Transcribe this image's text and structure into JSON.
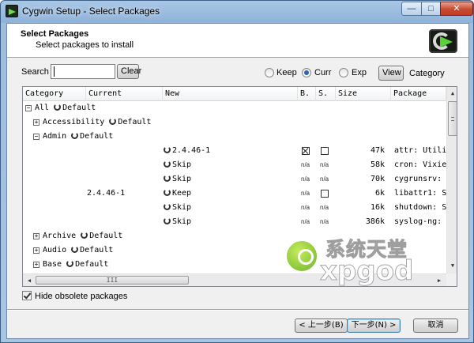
{
  "window": {
    "title": "Cygwin Setup - Select Packages",
    "minimize": "—",
    "maximize": "□",
    "close": "✕"
  },
  "header": {
    "title": "Select Packages",
    "subtitle": "Select packages to install"
  },
  "search": {
    "label": "Search",
    "value": "",
    "clear_label": "Clear"
  },
  "view_mode": {
    "options": [
      "Keep",
      "Curr",
      "Exp"
    ],
    "selected": "Curr",
    "view_button": "View",
    "current_view": "Category"
  },
  "columns": [
    "Category",
    "Current",
    "New",
    "B.",
    "S.",
    "Size",
    "Package"
  ],
  "tree": {
    "all": "All",
    "accessibility": "Accessibility",
    "admin": "Admin",
    "archive": "Archive",
    "audio": "Audio",
    "base": "Base",
    "default": "Default",
    "expand_sign": "+",
    "collapse_sign": "−"
  },
  "packages": [
    {
      "current": "",
      "new": "2.4.46-1",
      "bin": "checked",
      "src": "unchecked",
      "size": "47k",
      "package": "attr: Utili"
    },
    {
      "current": "",
      "new": "Skip",
      "bin": "n/a",
      "src": "n/a",
      "size": "58k",
      "package": "cron: Vixie"
    },
    {
      "current": "",
      "new": "Skip",
      "bin": "n/a",
      "src": "n/a",
      "size": "70k",
      "package": "cygrunsrv:"
    },
    {
      "current": "2.4.46-1",
      "new": "Keep",
      "bin": "n/a",
      "src": "unchecked",
      "size": "6k",
      "package": "libattr1: S"
    },
    {
      "current": "",
      "new": "Skip",
      "bin": "n/a",
      "src": "n/a",
      "size": "16k",
      "package": "shutdown: S"
    },
    {
      "current": "",
      "new": "Skip",
      "bin": "n/a",
      "src": "n/a",
      "size": "386k",
      "package": "syslog-ng:"
    }
  ],
  "na_text": "n/a",
  "scroll": {
    "up": "▲",
    "down": "▼",
    "left": "◀",
    "right": "▶",
    "grip": "III"
  },
  "options": {
    "hide_obsolete_label": "Hide obsolete packages",
    "hide_obsolete_checked": true
  },
  "buttons": {
    "back": "< 上一步(B)",
    "next": "下一步(N) >",
    "cancel": "取消"
  },
  "watermark": {
    "cn": "系统天堂",
    "en": "xpgod"
  }
}
